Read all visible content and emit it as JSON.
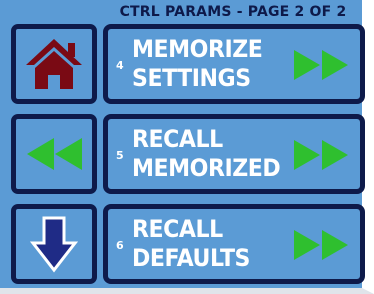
{
  "header": {
    "title": "CTRL PARAMS - PAGE 2 OF 2"
  },
  "side_buttons": [
    {
      "icon": "home-icon",
      "color": "#7a0a14"
    },
    {
      "icon": "rewind-icon",
      "color": "#2fbf2f"
    },
    {
      "icon": "down-arrow-icon",
      "color": "#1f2b86"
    }
  ],
  "actions": [
    {
      "number": "4",
      "line1": "MEMORIZE",
      "line2": "SETTINGS",
      "icon": "fast-forward-icon"
    },
    {
      "number": "5",
      "line1": "RECALL",
      "line2": "MEMORIZED",
      "icon": "fast-forward-icon"
    },
    {
      "number": "6",
      "line1": "RECALL",
      "line2": "DEFAULTS",
      "icon": "fast-forward-icon"
    }
  ],
  "colors": {
    "background": "#5b9bd5",
    "border": "#0e1a4a",
    "text": "#ffffff",
    "arrow_green": "#2fbf2f"
  }
}
